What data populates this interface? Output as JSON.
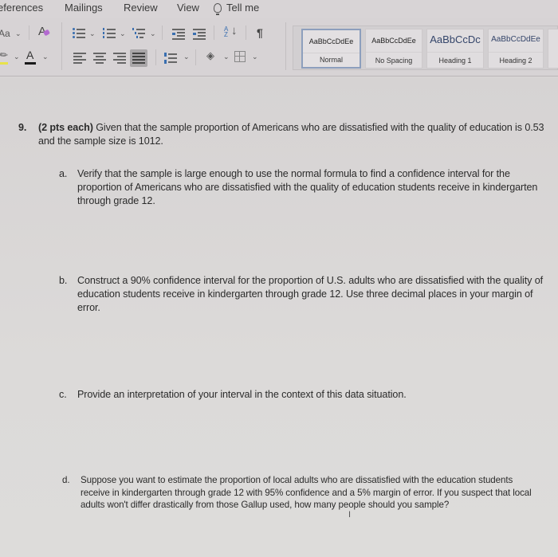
{
  "ribbon_tabs": [
    {
      "label": "eferences"
    },
    {
      "label": "Mailings"
    },
    {
      "label": "Review"
    },
    {
      "label": "View"
    },
    {
      "label": "Tell me",
      "icon": "lightbulb-icon"
    }
  ],
  "ribbon": {
    "font_case_label": "Aa",
    "clear_format_label": "A",
    "font_color_label": "A",
    "sort_label": "A Z",
    "pilcrow": "¶",
    "highlight_color": "#e8e24a",
    "font_color": "#1a1a1a"
  },
  "styles_gallery": [
    {
      "sample": "AaBbCcDdEe",
      "name": "Normal",
      "selected": true
    },
    {
      "sample": "AaBbCcDdEe",
      "name": "No Spacing",
      "selected": false
    },
    {
      "sample": "AaBbCcDc",
      "name": "Heading 1",
      "selected": false
    },
    {
      "sample": "AaBbCcDdEe",
      "name": "Heading 2",
      "selected": false
    }
  ],
  "document": {
    "question": {
      "number": "9.",
      "points": "(2 pts each)",
      "text": " Given that the sample proportion of Americans who are dissatisfied with the quality of education is 0.53 and the sample size is 1012."
    },
    "parts": [
      {
        "label": "a.",
        "text": "Verify that the sample is large enough to use the normal formula to find a confidence interval for the proportion of Americans who are dissatisfied with the quality of education students receive in kindergarten through grade 12."
      },
      {
        "label": "b.",
        "text": "Construct a 90% confidence interval for the proportion of U.S. adults who are dissatisfied with the quality of education students receive in kindergarten through grade 12. Use three decimal places in your margin of error."
      },
      {
        "label": "c.",
        "text": "Provide an interpretation of your interval in the context of this data situation."
      },
      {
        "label": "d.",
        "text": "Suppose you want to estimate the proportion of local adults who are dissatisfied with the education students receive in kindergarten through grade 12 with 95% confidence and a 5% margin of error. If you suspect that local adults won't differ drastically from those Gallup used, how many people should you sample?"
      }
    ]
  }
}
